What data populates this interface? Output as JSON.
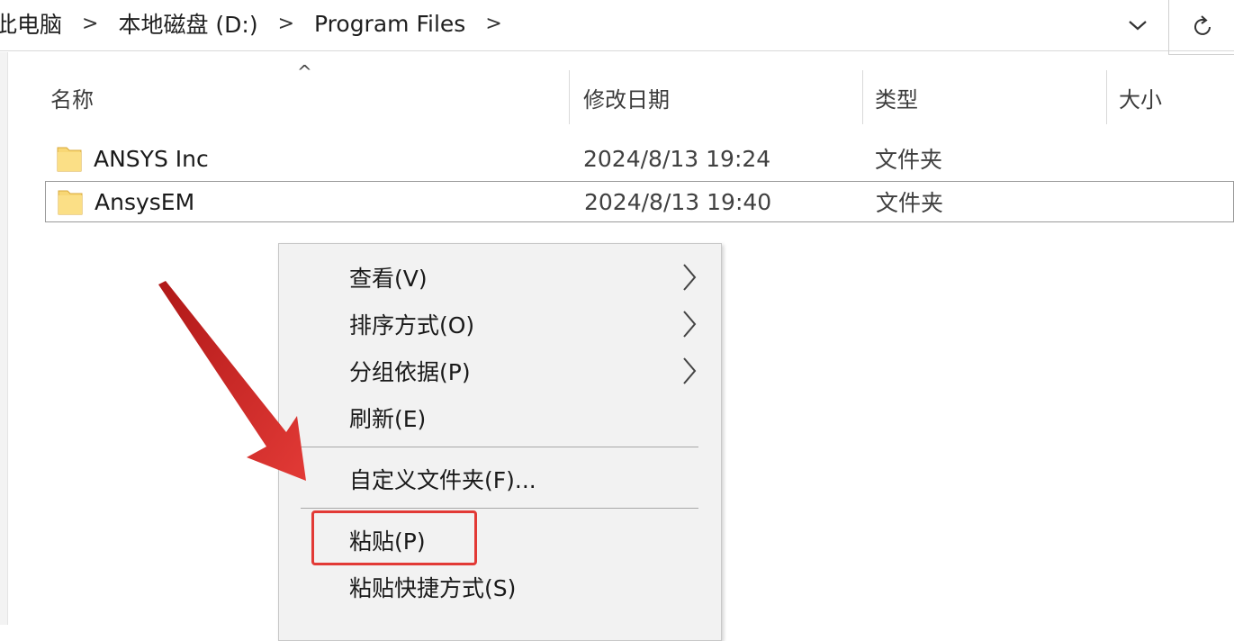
{
  "address": {
    "crumbs": [
      "此电脑",
      "本地磁盘 (D:)",
      "Program Files"
    ],
    "separator": ">",
    "dropdown_icon": "chevron-down-icon",
    "refresh_icon": "refresh-icon"
  },
  "columns": {
    "name": "名称",
    "date": "修改日期",
    "type": "类型",
    "size": "大小",
    "sort_icon": "^"
  },
  "files": [
    {
      "name": "ANSYS Inc",
      "date": "2024/8/13 19:24",
      "type": "文件夹"
    },
    {
      "name": "AnsysEM",
      "date": "2024/8/13 19:40",
      "type": "文件夹"
    }
  ],
  "context_menu": {
    "view": "查看(V)",
    "sort_by": "排序方式(O)",
    "group_by": "分组依据(P)",
    "refresh": "刷新(E)",
    "customize": "自定义文件夹(F)...",
    "paste": "粘贴(P)",
    "paste_shortcut": "粘贴快捷方式(S)"
  },
  "colors": {
    "annotation": "#e23a36",
    "folder": "#f8d775"
  }
}
